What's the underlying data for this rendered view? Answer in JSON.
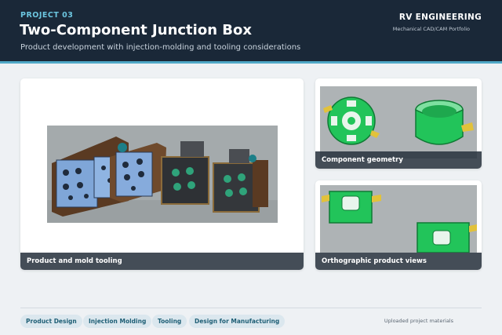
{
  "header": {
    "project_label": "PROJECT 03",
    "title": "Two-Component Junction Box",
    "subtitle": "Product development with injection-molding and tooling considerations",
    "brand": "RV ENGINEERING",
    "brand_tagline": "Mechanical CAD/CAM Portfolio"
  },
  "gallery": {
    "main_caption": "Product and mold tooling",
    "side_top_caption": "Component geometry",
    "side_bottom_caption": "Orthographic product views"
  },
  "footer": {
    "tags": [
      "Product Design",
      "Injection Molding",
      "Tooling",
      "Design for Manufacturing"
    ],
    "note": "Uploaded project materials"
  },
  "colors": {
    "header_bg": "#1a2838",
    "accent": "#4fa8c7",
    "part_green": "#22c45a",
    "mold_blue": "#7fa6d8",
    "mold_wood": "#8a5a32"
  }
}
